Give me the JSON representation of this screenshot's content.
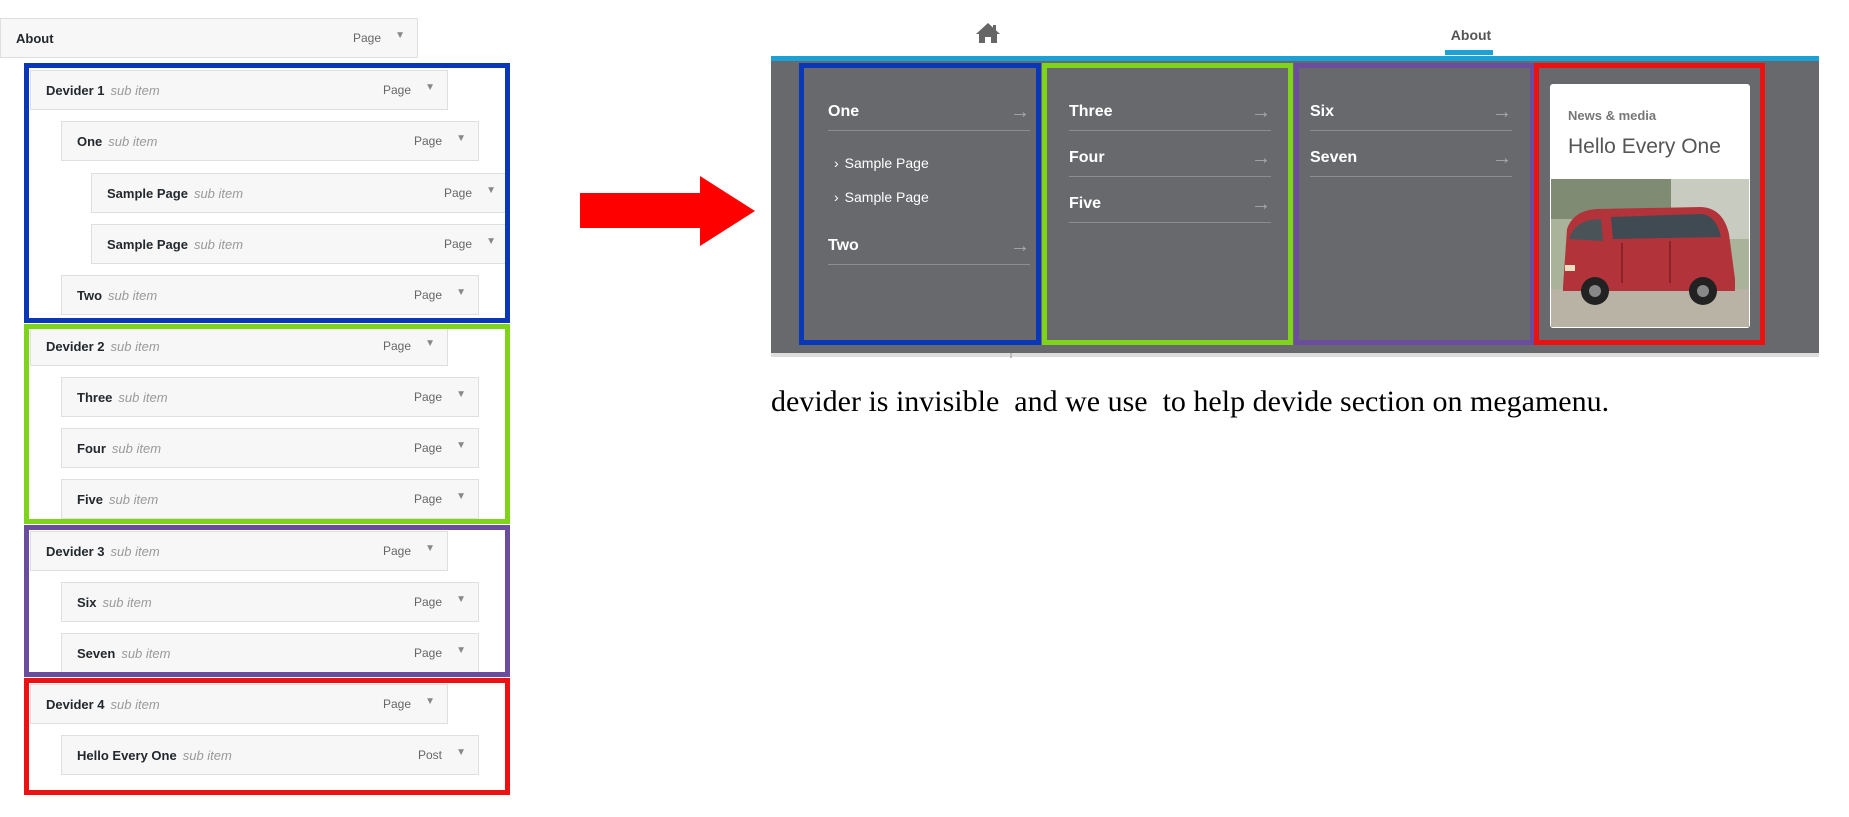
{
  "menu_editor": {
    "items": [
      {
        "title": "About",
        "sub": "",
        "type": "Page"
      },
      {
        "title": "Devider 1",
        "sub": "sub item",
        "type": "Page"
      },
      {
        "title": "One",
        "sub": "sub item",
        "type": "Page"
      },
      {
        "title": "Sample Page",
        "sub": "sub item",
        "type": "Page"
      },
      {
        "title": "Sample Page",
        "sub": "sub item",
        "type": "Page"
      },
      {
        "title": "Two",
        "sub": "sub item",
        "type": "Page"
      },
      {
        "title": "Devider 2",
        "sub": "sub item",
        "type": "Page"
      },
      {
        "title": "Three",
        "sub": "sub item",
        "type": "Page"
      },
      {
        "title": "Four",
        "sub": "sub item",
        "type": "Page"
      },
      {
        "title": "Five",
        "sub": "sub item",
        "type": "Page"
      },
      {
        "title": "Devider 3",
        "sub": "sub item",
        "type": "Page"
      },
      {
        "title": "Six",
        "sub": "sub item",
        "type": "Page"
      },
      {
        "title": "Seven",
        "sub": "sub item",
        "type": "Page"
      },
      {
        "title": "Devider 4",
        "sub": "sub item",
        "type": "Page"
      },
      {
        "title": "Hello Every One",
        "sub": "sub item",
        "type": "Post"
      }
    ],
    "dropdown_glyph": "▼"
  },
  "highlight_colors": {
    "blue": "#0a37b8",
    "green": "#7fd318",
    "purple": "#6a4d9c",
    "red": "#ee1111",
    "arrow": "#ff0000"
  },
  "nav": {
    "home_icon": "home-icon",
    "about_label": "About",
    "accent": "#1aa1d6"
  },
  "megamenu": {
    "background": "#67696d",
    "col1": {
      "item1": "One",
      "sub1": "Sample Page",
      "sub2": "Sample Page",
      "item2": "Two"
    },
    "col2": {
      "item1": "Three",
      "item2": "Four",
      "item3": "Five"
    },
    "col3": {
      "item1": "Six",
      "item2": "Seven"
    },
    "card": {
      "category": "News & media",
      "title": "Hello Every One",
      "image": "red-van-photo"
    },
    "arrow_glyph": "→",
    "chevron_glyph": "›"
  },
  "caption": "devider is invisible  and we use  to help devide section on megamenu."
}
